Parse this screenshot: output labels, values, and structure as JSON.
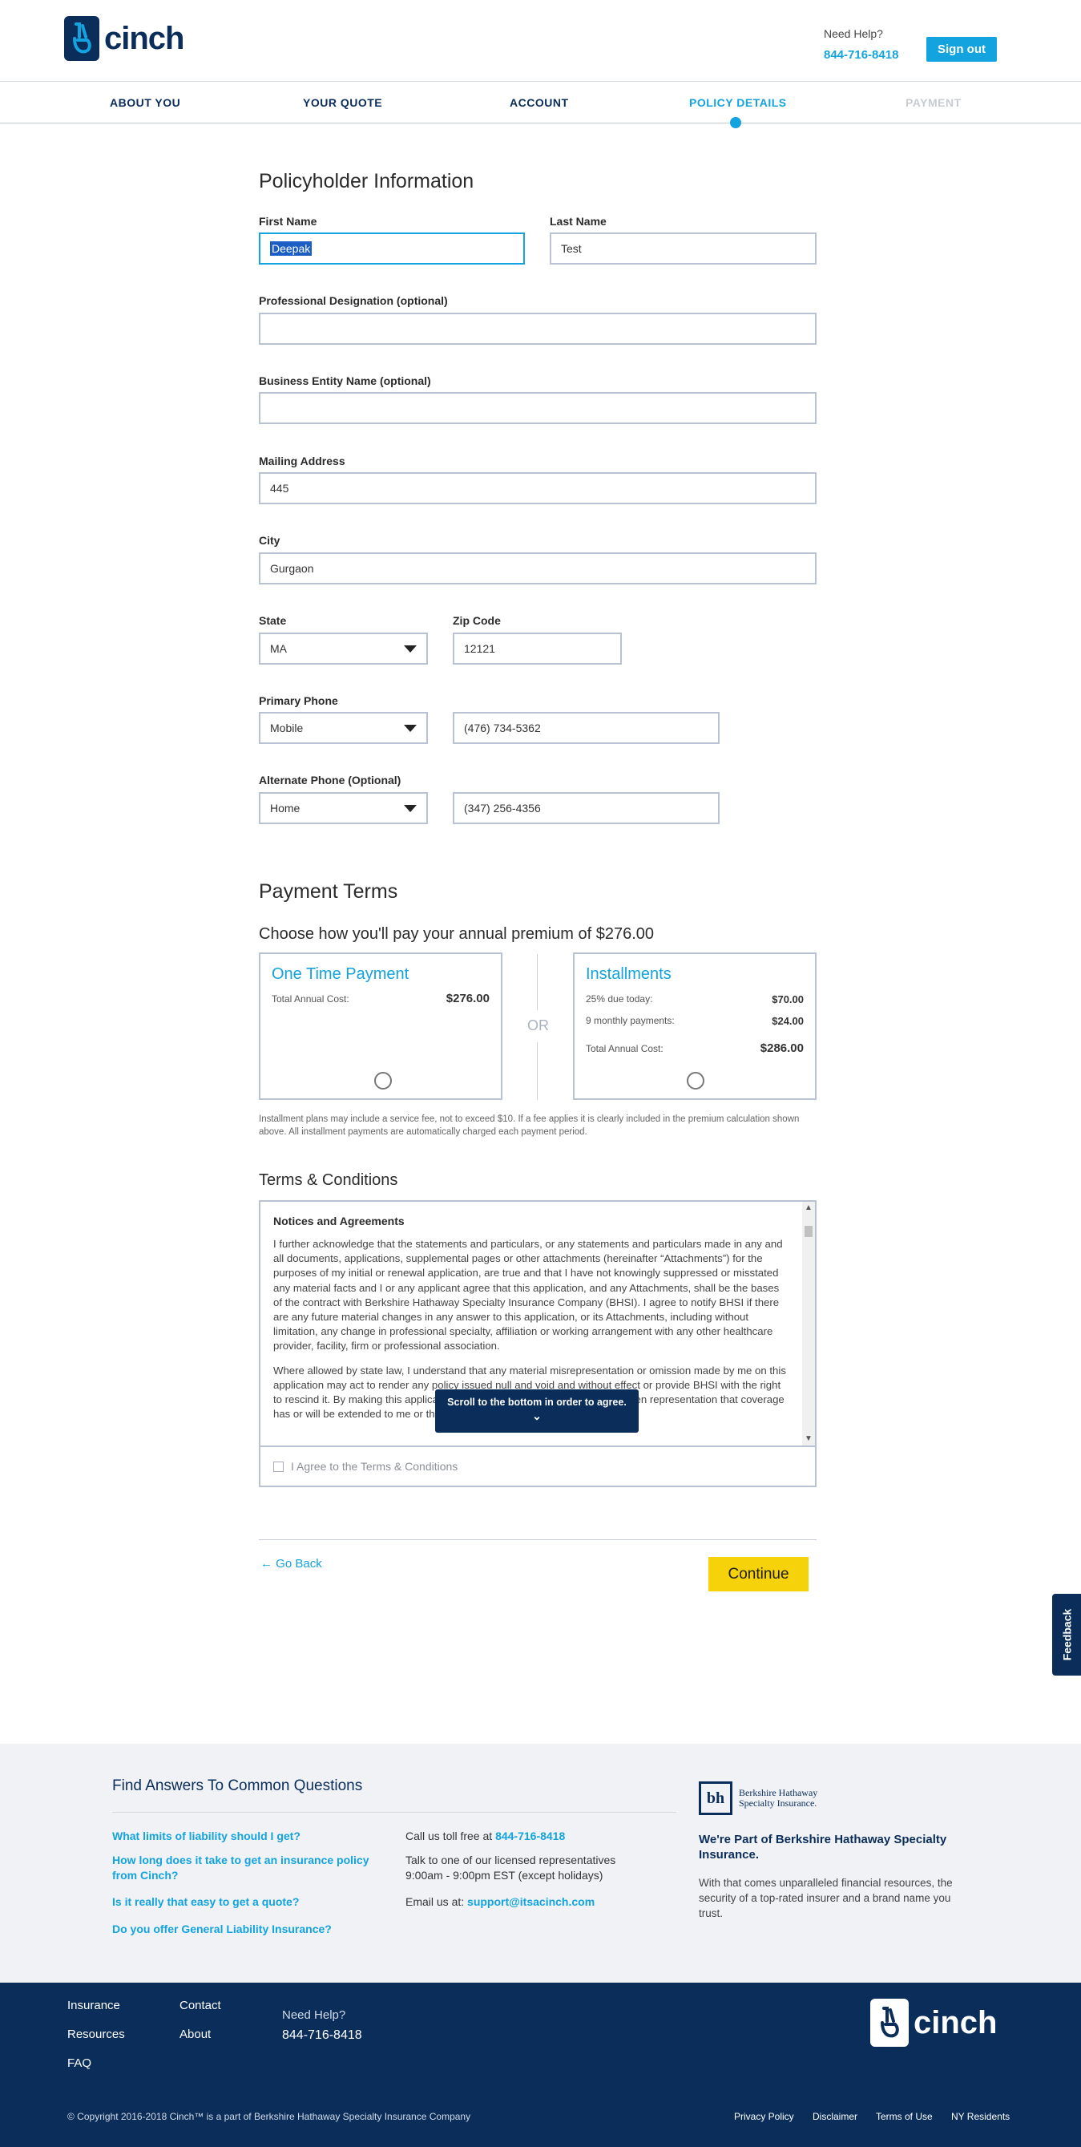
{
  "header": {
    "logo_text": "cinch",
    "help_label": "Need Help?",
    "help_phone": "844-716-8418",
    "signout_label": "Sign out"
  },
  "steps": [
    {
      "label": "ABOUT YOU",
      "state": "done"
    },
    {
      "label": "YOUR QUOTE",
      "state": "done"
    },
    {
      "label": "ACCOUNT",
      "state": "done"
    },
    {
      "label": "POLICY DETAILS",
      "state": "active"
    },
    {
      "label": "PAYMENT",
      "state": "disabled"
    }
  ],
  "policyholder": {
    "title": "Policyholder Information",
    "first_name_label": "First Name",
    "first_name_value": "Deepak",
    "last_name_label": "Last Name",
    "last_name_value": "Test",
    "designation_label": "Professional Designation (optional)",
    "designation_value": "",
    "entity_label": "Business Entity Name (optional)",
    "entity_value": "",
    "address_label": "Mailing Address",
    "address_value": "445",
    "city_label": "City",
    "city_value": "Gurgaon",
    "state_label": "State",
    "state_value": "MA",
    "zip_label": "Zip Code",
    "zip_value": "12121",
    "primary_phone_label": "Primary Phone",
    "primary_phone_type": "Mobile",
    "primary_phone_value": "(476) 734-5362",
    "alt_phone_label": "Alternate Phone (Optional)",
    "alt_phone_type": "Home",
    "alt_phone_value": "(347) 256-4356"
  },
  "payment": {
    "title": "Payment Terms",
    "subtitle": "Choose how you'll pay your annual premium of $276.00",
    "one_time": {
      "title": "One Time Payment",
      "total_label": "Total Annual Cost:",
      "total_value": "$276.00"
    },
    "or_label": "OR",
    "installments": {
      "title": "Installments",
      "due_label": "25% due today:",
      "due_value": "$70.00",
      "monthly_label": "9 monthly payments:",
      "monthly_value": "$24.00",
      "total_label": "Total Annual Cost:",
      "total_value": "$286.00"
    },
    "disclaimer": "Installment plans may include a service fee, not to exceed $10. If a fee applies it is clearly included in the premium calculation shown above. All installment payments are automatically charged each payment period."
  },
  "terms": {
    "title": "Terms & Conditions",
    "heading": "Notices and Agreements",
    "p1": "I further acknowledge that the statements and particulars, or any statements and particulars made in any and all documents, applications, supplemental pages or other attachments (hereinafter “Attachments”) for the purposes of my initial or renewal application, are true and that I have not knowingly suppressed or misstated any material facts and I or any applicant agree that this application, and any Attachments, shall be the bases of the contract with Berkshire Hathaway Specialty Insurance Company (BHSI). I agree to notify BHSI if there are any future material changes in any answer to this application, or its Attachments, including without limitation, any change in professional specialty, affiliation or working arrangement with any other healthcare provider, facility, firm or professional association.",
    "p2": "Where allowed by state law, I understand that any material misrepresentation or omission made by me on this application may act to render any policy issued null and void and without effect or provide BHSI with the right to rescind it. By making this application, I am not relying upon any oral or written representation that coverage has or will be extended to me or that a policy of insurance will be issued.",
    "tooltip": "Scroll to the bottom in order to agree.",
    "agree_label": "I Agree to the Terms & Conditions"
  },
  "actions": {
    "back_label": "Go Back",
    "continue_label": "Continue"
  },
  "feedback_label": "Feedback",
  "faq": {
    "title": "Find Answers To Common Questions",
    "questions": [
      "What limits of liability should I get?",
      "How long does it take to get an insurance policy from Cinch?",
      "Is it really that easy to get a quote?",
      "Do you offer General Liability Insurance?"
    ],
    "call_prefix": "Call us toll free at",
    "call_phone": "844-716-8418",
    "talk_text": "Talk to one of our licensed representatives 9:00am - 9:00pm EST (except holidays)",
    "email_prefix": "Email us at:",
    "email": "support@itsacinch.com",
    "bh_logo_mark": "bh",
    "bh_logo_name": "Berkshire Hathaway Specialty Insurance.",
    "bh_heading": "We're Part of Berkshire Hathaway Specialty Insurance.",
    "bh_text": "With that comes unparalleled financial resources, the security of a top-rated insurer and a brand name you trust."
  },
  "footer": {
    "links_col1": [
      "Insurance",
      "Resources",
      "FAQ"
    ],
    "links_col2": [
      "Contact",
      "About"
    ],
    "help_label": "Need Help?",
    "help_phone": "844-716-8418",
    "logo_text": "cinch",
    "copyright": "© Copyright 2016-2018 Cinch™ is a part of Berkshire Hathaway Specialty Insurance Company",
    "legal": [
      "Privacy Policy",
      "Disclaimer",
      "Terms of Use",
      "NY Residents"
    ]
  },
  "colors": {
    "brand_navy": "#0a2d5a",
    "accent_blue": "#13a3de",
    "continue_yellow": "#f5d20a"
  }
}
